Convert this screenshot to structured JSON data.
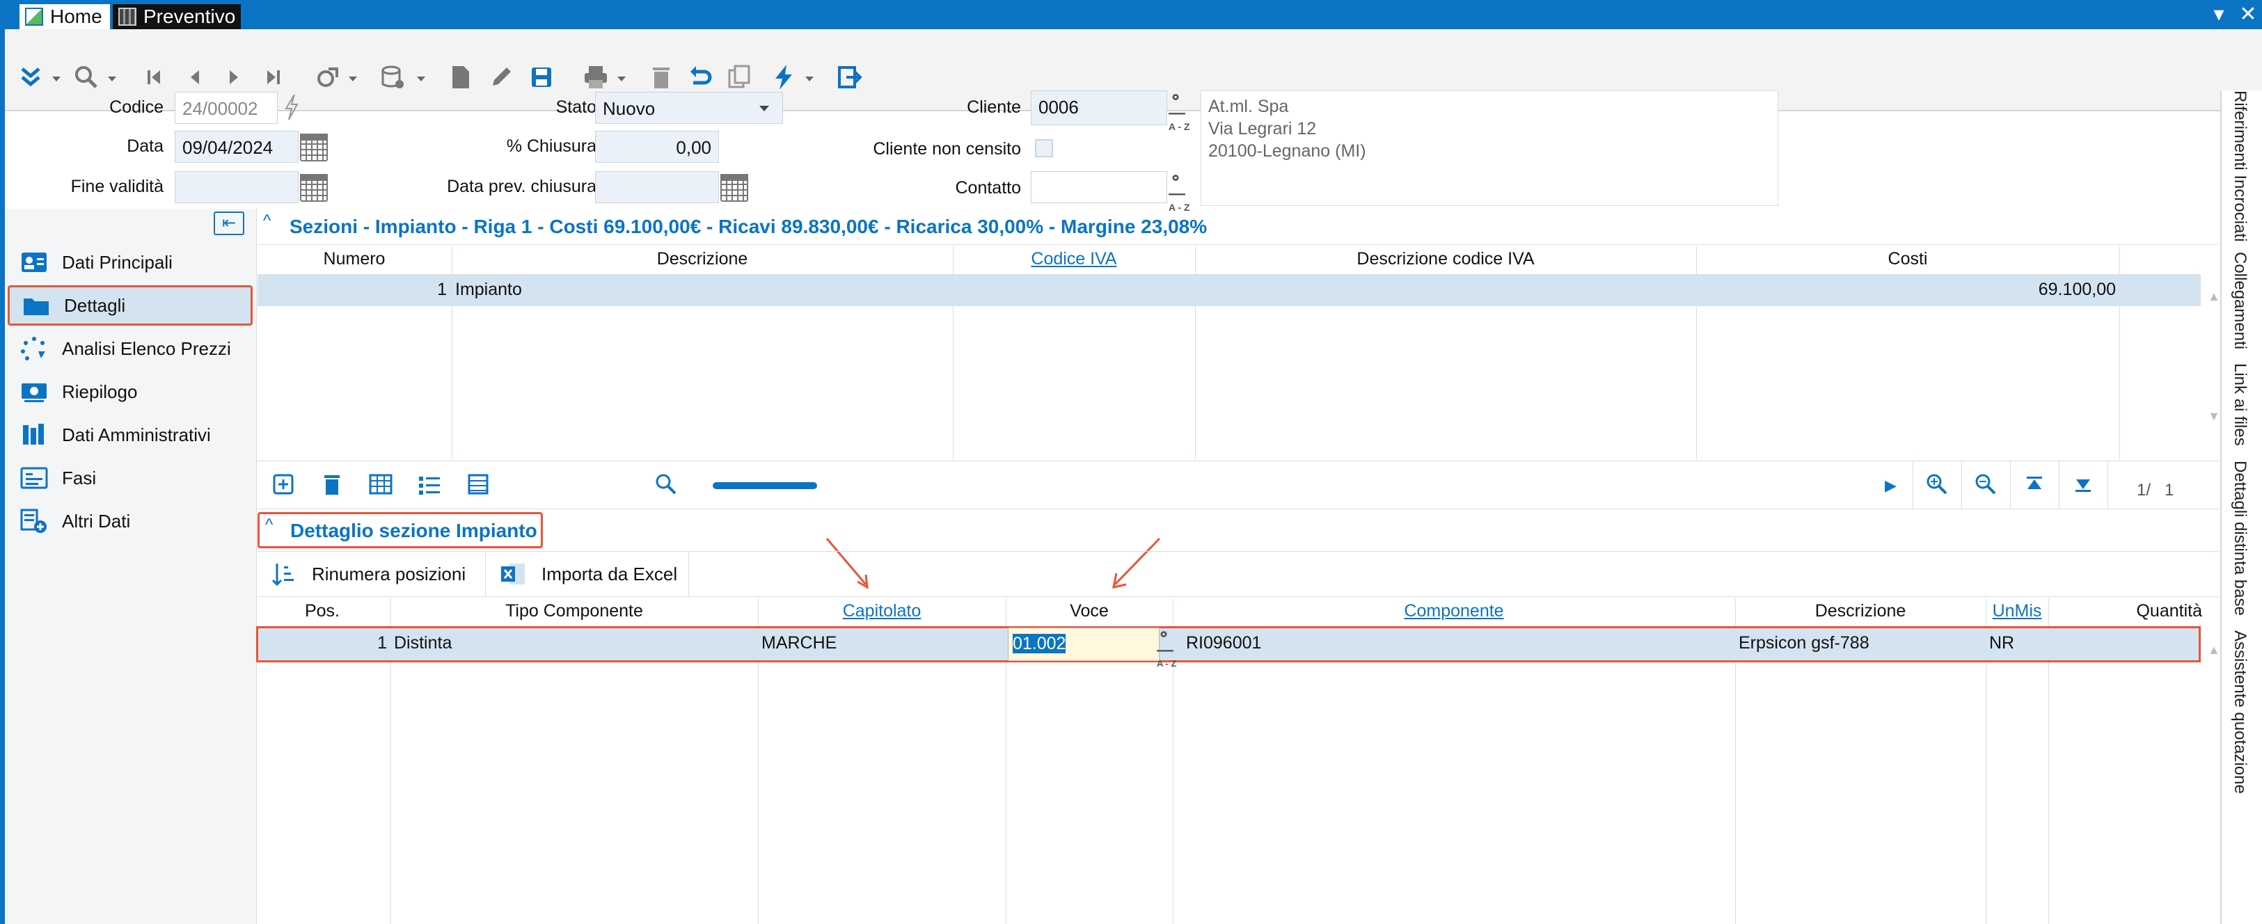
{
  "window": {
    "tabs": [
      {
        "label": "Home"
      },
      {
        "label": "Preventivo"
      }
    ]
  },
  "header": {
    "codice_label": "Codice",
    "codice_value": "24/00002",
    "data_label": "Data",
    "data_value": "09/04/2024",
    "fine_validita_label": "Fine validità",
    "fine_validita_value": "",
    "stato_label": "Stato",
    "stato_value": "Nuovo",
    "chiusura_label": "% Chiusura",
    "chiusura_value": "0,00",
    "data_prev_label": "Data prev. chiusura",
    "data_prev_value": "",
    "cliente_label": "Cliente",
    "cliente_value": "0006",
    "cliente_non_censito_label": "Cliente non censito",
    "contatto_label": "Contatto",
    "contatto_value": "",
    "address_lines": [
      "At.ml. Spa",
      "Via Legrari 12",
      "20100-Legnano (MI)"
    ],
    "lookup_text": "A - Z"
  },
  "right_tabs": [
    "Riferimenti Incrociati",
    "Collegamenti",
    "Link ai files",
    "Dettagli distinta base",
    "Assistente quotazione"
  ],
  "sidebar": {
    "items": [
      {
        "label": "Dati Principali",
        "icon": "contact-card-icon"
      },
      {
        "label": "Dettagli",
        "icon": "folder-icon"
      },
      {
        "label": "Analisi Elenco Prezzi",
        "icon": "analysis-dots-icon"
      },
      {
        "label": "Riepilogo",
        "icon": "money-icon"
      },
      {
        "label": "Dati Amministrativi",
        "icon": "books-icon"
      },
      {
        "label": "Fasi",
        "icon": "list-card-icon"
      },
      {
        "label": "Altri Dati",
        "icon": "add-data-icon"
      }
    ]
  },
  "section1": {
    "title": "Sezioni - Impianto - Riga 1 - Costi 69.100,00€ - Ricavi 89.830,00€ - Ricarica 30,00% - Margine 23,08%",
    "columns": [
      "Numero",
      "Descrizione",
      "Codice IVA",
      "Descrizione codice IVA",
      "Costi"
    ],
    "rows": [
      {
        "numero": "1",
        "descrizione": "Impianto",
        "codice_iva": "",
        "descrizione_iva": "",
        "costi": "69.100,00"
      }
    ],
    "pager": "1/   1"
  },
  "section2": {
    "title": "Dettaglio sezione Impianto",
    "buttons": {
      "rinumera": "Rinumera posizioni",
      "importa": "Importa da Excel"
    },
    "columns": [
      "Pos.",
      "Tipo Componente",
      "Capitolato",
      "Voce",
      "Componente",
      "Descrizione",
      "UnMis",
      "Quantità"
    ],
    "rows": [
      {
        "pos": "1",
        "tipo": "Distinta",
        "capitolato": "MARCHE",
        "voce": "01.002",
        "componente": "RI096001",
        "descrizione": "Erpsicon gsf-788",
        "unmis": "NR",
        "quantita": ""
      }
    ]
  },
  "colors": {
    "accent": "#0b74c4",
    "highlight": "#e8553a",
    "selected_row": "#d4e3f0"
  }
}
